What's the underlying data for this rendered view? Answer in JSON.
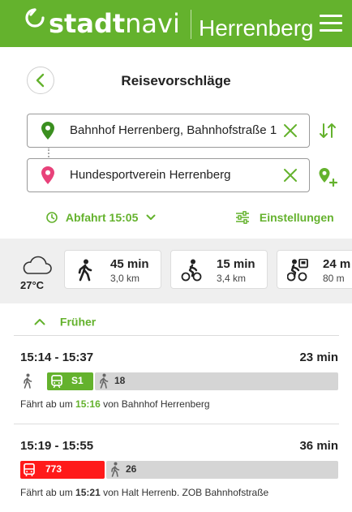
{
  "header": {
    "brand_bold": "stadt",
    "brand_light": "navi",
    "city": "Herrenberg"
  },
  "page": {
    "title": "Reisevorschläge"
  },
  "origin": {
    "value": "Bahnhof Herrenberg, Bahnhofstraße 1"
  },
  "destination": {
    "value": "Hundesportverein Herrenberg"
  },
  "departure": {
    "label": "Abfahrt 15:05"
  },
  "settings": {
    "label": "Einstellungen"
  },
  "weather": {
    "temp": "27°C"
  },
  "modes": [
    {
      "time": "45 min",
      "dist": "3,0 km"
    },
    {
      "time": "15 min",
      "dist": "3,4 km"
    },
    {
      "time": "24 m",
      "dist": "80 m"
    }
  ],
  "earlier": {
    "label": "Früher"
  },
  "itineraries": [
    {
      "time": "15:14 - 15:37",
      "duration": "23 min",
      "transit_label": "S1",
      "walk_minutes": "18",
      "info_prefix": "Fährt ab um",
      "info_time": "15:16",
      "info_mid": "von",
      "info_stop": "Bahnhof Herrenberg"
    },
    {
      "time": "15:19 - 15:55",
      "duration": "36 min",
      "transit_label": "773",
      "walk_minutes": "26",
      "info_prefix": "Fährt ab um",
      "info_time": "15:21",
      "info_mid": "von",
      "info_stop": "Halt Herrenb. ZOB Bahnhofstraße"
    }
  ],
  "colors": {
    "brand": "#64b22d",
    "bus": "#ff1a1a",
    "origin_pin": "#3a8f1f",
    "destination_pin": "#e8427a"
  }
}
